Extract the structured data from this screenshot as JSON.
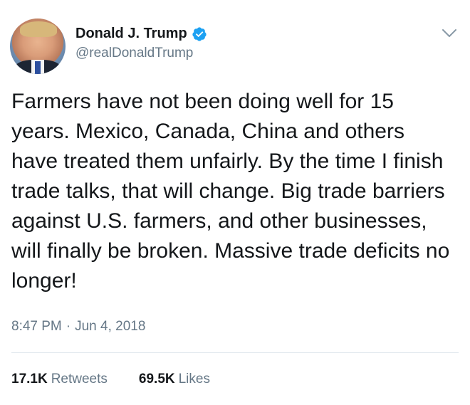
{
  "header": {
    "display_name": "Donald J. Trump",
    "handle": "@realDonaldTrump",
    "verified": true,
    "avatar_icon": "profile-photo",
    "menu_icon": "chevron-down-icon"
  },
  "tweet": {
    "text": "Farmers have not been doing well for 15 years. Mexico, Canada, China and others have treated them unfairly. By the time I finish trade talks, that will change. Big trade barriers against U.S. farmers, and other businesses, will finally be broken. Massive trade deficits no longer!",
    "time": "8:47 PM",
    "separator": "·",
    "date": "Jun 4, 2018"
  },
  "stats": {
    "retweets_count": "17.1K",
    "retweets_label": "Retweets",
    "likes_count": "69.5K",
    "likes_label": "Likes"
  },
  "colors": {
    "verified_blue": "#1da1f2",
    "secondary_text": "#657786",
    "primary_text": "#14171a",
    "divider": "#e1e8ed"
  }
}
